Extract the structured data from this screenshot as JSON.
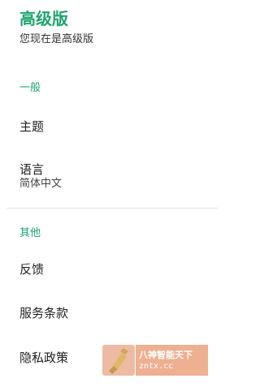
{
  "header": {
    "title": "高级版",
    "subtitle": "您现在是高级版"
  },
  "sections": [
    {
      "label": "一般",
      "items": [
        {
          "title": "主题"
        },
        {
          "title": "语言",
          "subtitle": "简体中文"
        }
      ]
    },
    {
      "label": "其他",
      "items": [
        {
          "title": "反馈"
        },
        {
          "title": "服务条款"
        },
        {
          "title": "隐私政策"
        }
      ]
    }
  ],
  "watermark": {
    "line1": "八神智能天下",
    "line2": "zntx.cc"
  },
  "colors": {
    "accent": "#1fa56f",
    "divider": "#e4e4e4"
  }
}
